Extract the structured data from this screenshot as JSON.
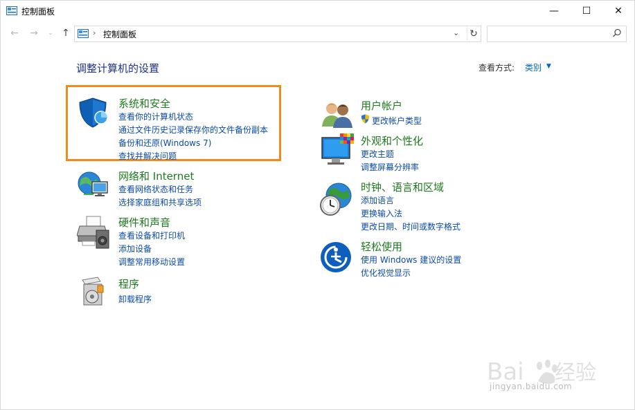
{
  "window": {
    "title": "控制面板",
    "controls": {
      "minimize": "—",
      "maximize": "☐",
      "close": "✕"
    }
  },
  "nav": {
    "back": "←",
    "forward": "→",
    "recent": "⌄",
    "up": "↑",
    "address_sep": "›",
    "address": "控制面板",
    "address_drop": "⌄",
    "refresh": "↻",
    "search_placeholder": ""
  },
  "page": {
    "title": "调整计算机的设置",
    "view_by_label": "查看方式:",
    "view_by_value": "类别",
    "view_by_arrow": "▼"
  },
  "left_categories": [
    {
      "title": "系统和安全",
      "icon": "shield-icon",
      "links": [
        "查看你的计算机状态",
        "通过文件历史记录保存你的文件备份副本",
        "备份和还原(Windows 7)",
        "查找并解决问题"
      ]
    },
    {
      "title": "网络和 Internet",
      "icon": "network-icon",
      "links": [
        "查看网络状态和任务",
        "选择家庭组和共享选项"
      ]
    },
    {
      "title": "硬件和声音",
      "icon": "printer-icon",
      "links": [
        "查看设备和打印机",
        "添加设备",
        "调整常用移动设置"
      ]
    },
    {
      "title": "程序",
      "icon": "programs-icon",
      "links": [
        "卸载程序"
      ]
    }
  ],
  "right_categories": [
    {
      "title": "用户帐户",
      "icon": "users-icon",
      "links": [
        "更改帐户类型"
      ]
    },
    {
      "title": "外观和个性化",
      "icon": "monitor-icon",
      "links": [
        "更改主题",
        "调整屏幕分辨率"
      ]
    },
    {
      "title": "时钟、语言和区域",
      "icon": "globe-clock-icon",
      "links": [
        "添加语言",
        "更换输入法",
        "更改日期、时间或数字格式"
      ]
    },
    {
      "title": "轻松使用",
      "icon": "ease-of-access-icon",
      "links": [
        "使用 Windows 建议的设置",
        "优化视觉显示"
      ]
    }
  ],
  "colors": {
    "category_title": "#1e7a1e",
    "link": "#0b4ba8",
    "highlight_border": "#f08a1c",
    "page_title": "#1e3287"
  },
  "watermark": {
    "text": "jingyan.baidu.com"
  }
}
